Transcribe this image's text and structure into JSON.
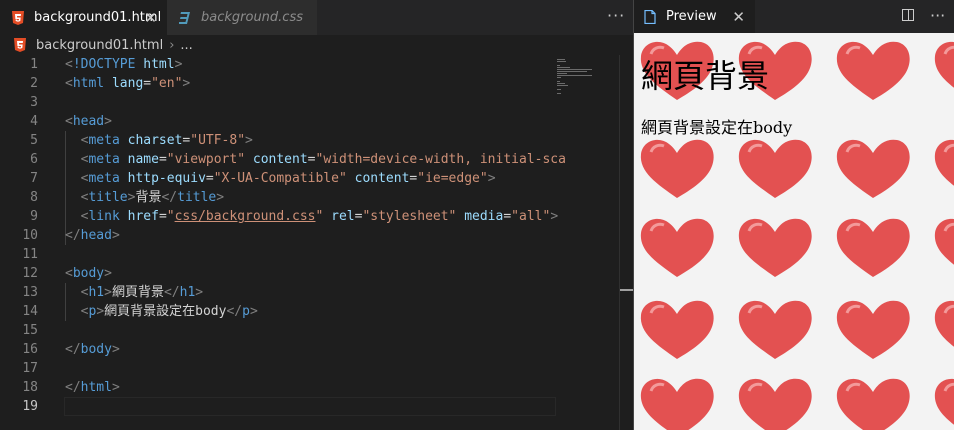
{
  "tabs": [
    {
      "label": "background01.html",
      "active": true
    },
    {
      "label": "background.css",
      "active": false
    }
  ],
  "tab_actions_glyph": "···",
  "breadcrumb": {
    "file": "background01.html",
    "sep": "›",
    "more": "..."
  },
  "code_lines": [
    {
      "n": "1",
      "tokens": [
        [
          "p",
          "<"
        ],
        [
          "t",
          "!DOCTYPE"
        ],
        [
          "x",
          " "
        ],
        [
          "a",
          "html"
        ],
        [
          "p",
          ">"
        ]
      ]
    },
    {
      "n": "2",
      "tokens": [
        [
          "p",
          "<"
        ],
        [
          "t",
          "html"
        ],
        [
          "x",
          " "
        ],
        [
          "a",
          "lang"
        ],
        [
          "x",
          "="
        ],
        [
          "s",
          "\"en\""
        ],
        [
          "p",
          ">"
        ]
      ]
    },
    {
      "n": "3",
      "tokens": []
    },
    {
      "n": "4",
      "tokens": [
        [
          "p",
          "<"
        ],
        [
          "t",
          "head"
        ],
        [
          "p",
          ">"
        ]
      ]
    },
    {
      "n": "5",
      "tokens": [
        [
          "x",
          "  "
        ],
        [
          "p",
          "<"
        ],
        [
          "t",
          "meta"
        ],
        [
          "x",
          " "
        ],
        [
          "a",
          "charset"
        ],
        [
          "x",
          "="
        ],
        [
          "s",
          "\"UTF-8\""
        ],
        [
          "p",
          ">"
        ]
      ]
    },
    {
      "n": "6",
      "tokens": [
        [
          "x",
          "  "
        ],
        [
          "p",
          "<"
        ],
        [
          "t",
          "meta"
        ],
        [
          "x",
          " "
        ],
        [
          "a",
          "name"
        ],
        [
          "x",
          "="
        ],
        [
          "s",
          "\"viewport\""
        ],
        [
          "x",
          " "
        ],
        [
          "a",
          "content"
        ],
        [
          "x",
          "="
        ],
        [
          "s",
          "\"width=device-width, initial-sca"
        ]
      ]
    },
    {
      "n": "7",
      "tokens": [
        [
          "x",
          "  "
        ],
        [
          "p",
          "<"
        ],
        [
          "t",
          "meta"
        ],
        [
          "x",
          " "
        ],
        [
          "a",
          "http-equiv"
        ],
        [
          "x",
          "="
        ],
        [
          "s",
          "\"X-UA-Compatible\""
        ],
        [
          "x",
          " "
        ],
        [
          "a",
          "content"
        ],
        [
          "x",
          "="
        ],
        [
          "s",
          "\"ie=edge\""
        ],
        [
          "p",
          ">"
        ]
      ]
    },
    {
      "n": "8",
      "tokens": [
        [
          "x",
          "  "
        ],
        [
          "p",
          "<"
        ],
        [
          "t",
          "title"
        ],
        [
          "p",
          ">"
        ],
        [
          "x",
          "背景"
        ],
        [
          "p",
          "</"
        ],
        [
          "t",
          "title"
        ],
        [
          "p",
          ">"
        ]
      ]
    },
    {
      "n": "9",
      "tokens": [
        [
          "x",
          "  "
        ],
        [
          "p",
          "<"
        ],
        [
          "t",
          "link"
        ],
        [
          "x",
          " "
        ],
        [
          "a",
          "href"
        ],
        [
          "x",
          "="
        ],
        [
          "s",
          "\""
        ],
        [
          "su",
          "css/background.css"
        ],
        [
          "s",
          "\""
        ],
        [
          "x",
          " "
        ],
        [
          "a",
          "rel"
        ],
        [
          "x",
          "="
        ],
        [
          "s",
          "\"stylesheet\""
        ],
        [
          "x",
          " "
        ],
        [
          "a",
          "media"
        ],
        [
          "x",
          "="
        ],
        [
          "s",
          "\"all\""
        ],
        [
          "p",
          ">"
        ]
      ]
    },
    {
      "n": "10",
      "tokens": [
        [
          "p",
          "</"
        ],
        [
          "t",
          "head"
        ],
        [
          "p",
          ">"
        ]
      ]
    },
    {
      "n": "11",
      "tokens": []
    },
    {
      "n": "12",
      "tokens": [
        [
          "p",
          "<"
        ],
        [
          "t",
          "body"
        ],
        [
          "p",
          ">"
        ]
      ]
    },
    {
      "n": "13",
      "tokens": [
        [
          "x",
          "  "
        ],
        [
          "p",
          "<"
        ],
        [
          "t",
          "h1"
        ],
        [
          "p",
          ">"
        ],
        [
          "x",
          "網頁背景"
        ],
        [
          "p",
          "</"
        ],
        [
          "t",
          "h1"
        ],
        [
          "p",
          ">"
        ]
      ]
    },
    {
      "n": "14",
      "tokens": [
        [
          "x",
          "  "
        ],
        [
          "p",
          "<"
        ],
        [
          "t",
          "p"
        ],
        [
          "p",
          ">"
        ],
        [
          "x",
          "網頁背景設定在body"
        ],
        [
          "p",
          "</"
        ],
        [
          "t",
          "p"
        ],
        [
          "p",
          ">"
        ]
      ]
    },
    {
      "n": "15",
      "tokens": []
    },
    {
      "n": "16",
      "tokens": [
        [
          "p",
          "</"
        ],
        [
          "t",
          "body"
        ],
        [
          "p",
          ">"
        ]
      ]
    },
    {
      "n": "17",
      "tokens": []
    },
    {
      "n": "18",
      "tokens": [
        [
          "p",
          "</"
        ],
        [
          "t",
          "html"
        ],
        [
          "p",
          ">"
        ]
      ]
    },
    {
      "n": "19",
      "tokens": []
    }
  ],
  "preview": {
    "tab_label": "Preview",
    "h1": "網頁背景",
    "p": "網頁背景設定在body"
  },
  "colors": {
    "tag": "#569cd6",
    "attr": "#9cdcfe",
    "string": "#ce9178",
    "punct": "#808080",
    "heart": "#e03a3a",
    "preview_bg": "#f3f3f3"
  },
  "icons": [
    "html-file-icon",
    "css-file-icon",
    "preview-icon",
    "close-icon",
    "split-editor-icon",
    "more-actions-icon",
    "chevron-right-icon"
  ]
}
